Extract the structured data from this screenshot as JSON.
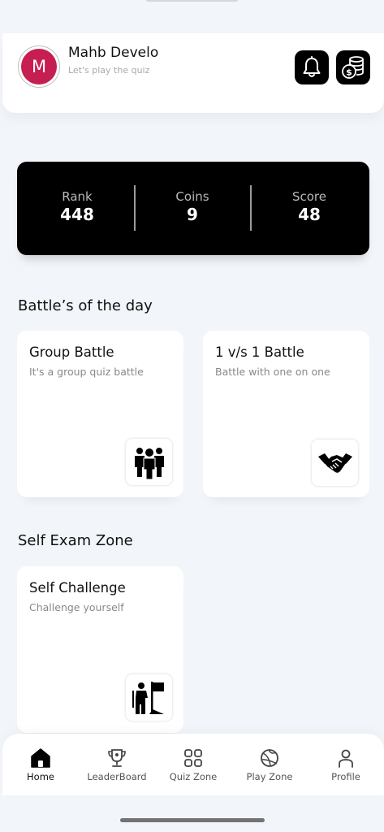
{
  "header": {
    "avatar_letter": "M",
    "user_name": "Mahb Develo",
    "tagline": "Let's play the quiz"
  },
  "stats": {
    "rank_label": "Rank",
    "rank_value": "448",
    "coins_label": "Coins",
    "coins_value": "9",
    "score_label": "Score",
    "score_value": "48"
  },
  "battles": {
    "title": "Battle’s of the day",
    "group": {
      "title": "Group Battle",
      "subtitle": "It's a group quiz battle",
      "icon": "group-people-icon"
    },
    "one_vs_one": {
      "title": "1 v/s 1 Battle",
      "subtitle": "Battle with one on one",
      "icon": "handshake-icon"
    }
  },
  "self_exam": {
    "title": "Self Exam Zone",
    "challenge": {
      "title": "Self Challenge",
      "subtitle": "Challenge yourself",
      "icon": "goal-flag-icon"
    }
  },
  "nav": [
    {
      "label": "Home",
      "icon": "home-icon",
      "active": true
    },
    {
      "label": "LeaderBoard",
      "icon": "trophy-icon",
      "active": false
    },
    {
      "label": "Quiz Zone",
      "icon": "grid-icon",
      "active": false
    },
    {
      "label": "Play Zone",
      "icon": "ball-icon",
      "active": false
    },
    {
      "label": "Profile",
      "icon": "person-icon",
      "active": false
    }
  ],
  "colors": {
    "accent_dark": "#000000",
    "avatar_bg": "#c71e52",
    "background": "#f2f5f9"
  }
}
